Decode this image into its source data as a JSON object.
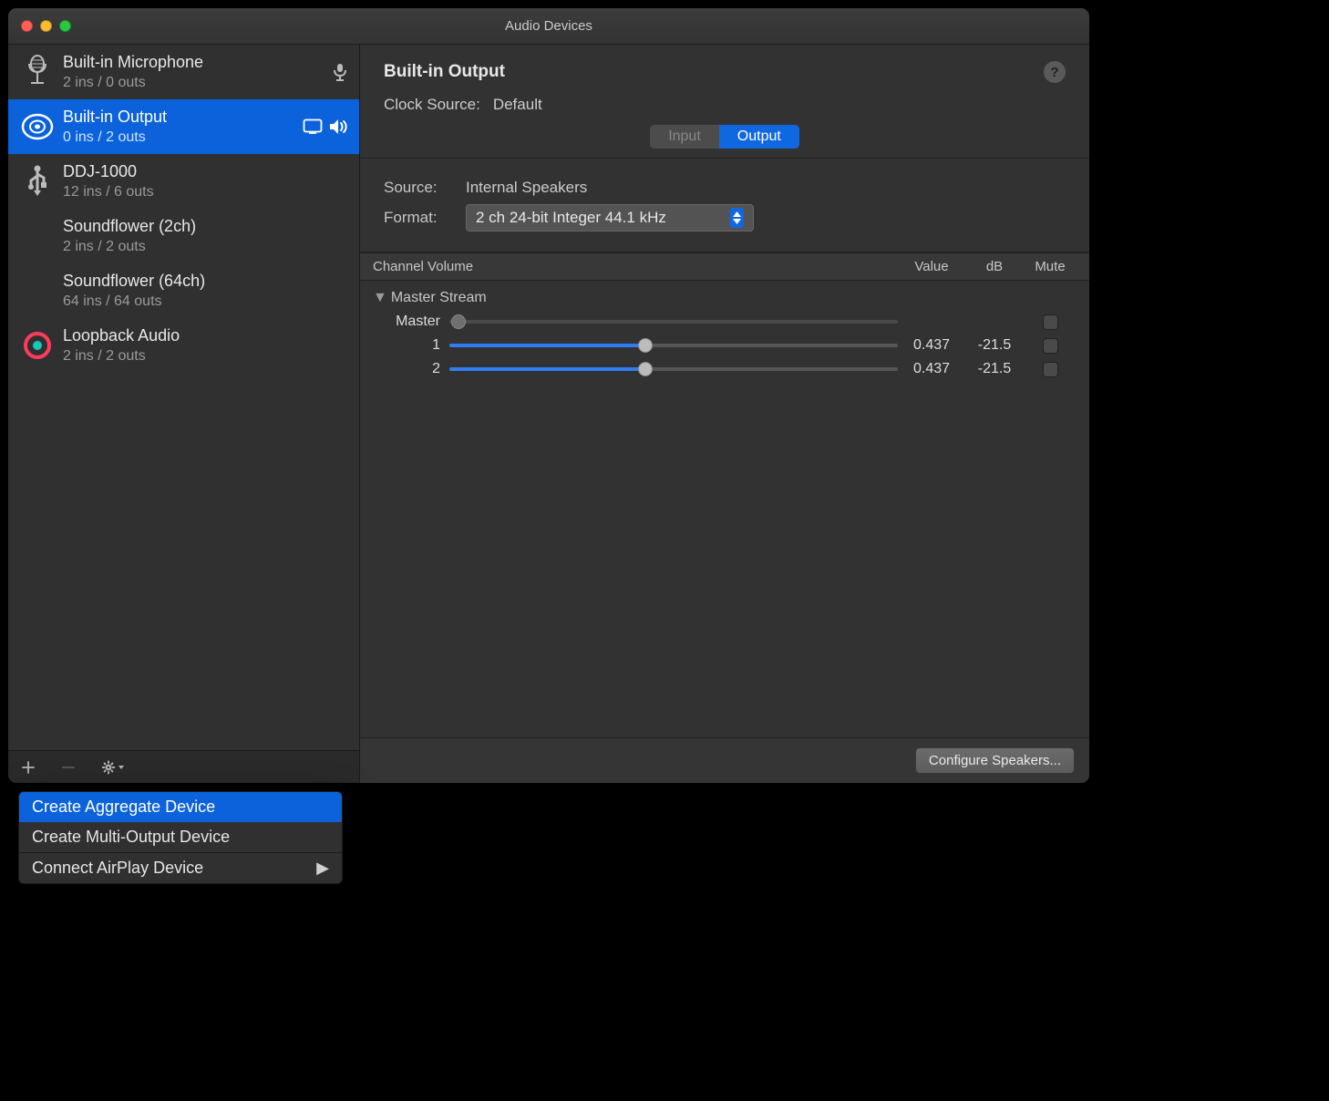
{
  "window": {
    "title": "Audio Devices"
  },
  "sidebar": {
    "devices": [
      {
        "icon": "mic",
        "name": "Built-in Microphone",
        "sub": "2 ins / 0 outs",
        "trailing_in": true
      },
      {
        "icon": "speaker",
        "name": "Built-in Output",
        "sub": "0 ins / 2 outs",
        "selected": true,
        "trailing_out": true,
        "trailing_monitor": true
      },
      {
        "icon": "usb",
        "name": "DDJ-1000",
        "sub": "12 ins / 6 outs"
      },
      {
        "icon": "none",
        "name": "Soundflower (2ch)",
        "sub": "2 ins / 2 outs"
      },
      {
        "icon": "none",
        "name": "Soundflower (64ch)",
        "sub": "64 ins / 64 outs"
      },
      {
        "icon": "loopback",
        "name": "Loopback Audio",
        "sub": "2 ins / 2 outs"
      }
    ]
  },
  "main": {
    "title": "Built-in Output",
    "clock_label": "Clock Source:",
    "clock_value": "Default",
    "tabs": {
      "input": "Input",
      "output": "Output",
      "active": "output"
    },
    "source_label": "Source:",
    "source_value": "Internal Speakers",
    "format_label": "Format:",
    "format_value": "2 ch 24-bit Integer 44.1 kHz",
    "volume_header": {
      "name": "Channel Volume",
      "value": "Value",
      "db": "dB",
      "mute": "Mute"
    },
    "stream_name": "Master Stream",
    "channels": [
      {
        "label": "Master",
        "value_pos": 0.02,
        "value": "",
        "db": "",
        "disabled": true
      },
      {
        "label": "1",
        "value_pos": 0.437,
        "value": "0.437",
        "db": "-21.5"
      },
      {
        "label": "2",
        "value_pos": 0.437,
        "value": "0.437",
        "db": "-21.5"
      }
    ],
    "configure": "Configure Speakers..."
  },
  "popup": {
    "items": [
      {
        "label": "Create Aggregate Device",
        "highlight": true
      },
      {
        "label": "Create Multi-Output Device"
      }
    ],
    "footer": {
      "label": "Connect AirPlay Device",
      "submenu": true
    }
  }
}
